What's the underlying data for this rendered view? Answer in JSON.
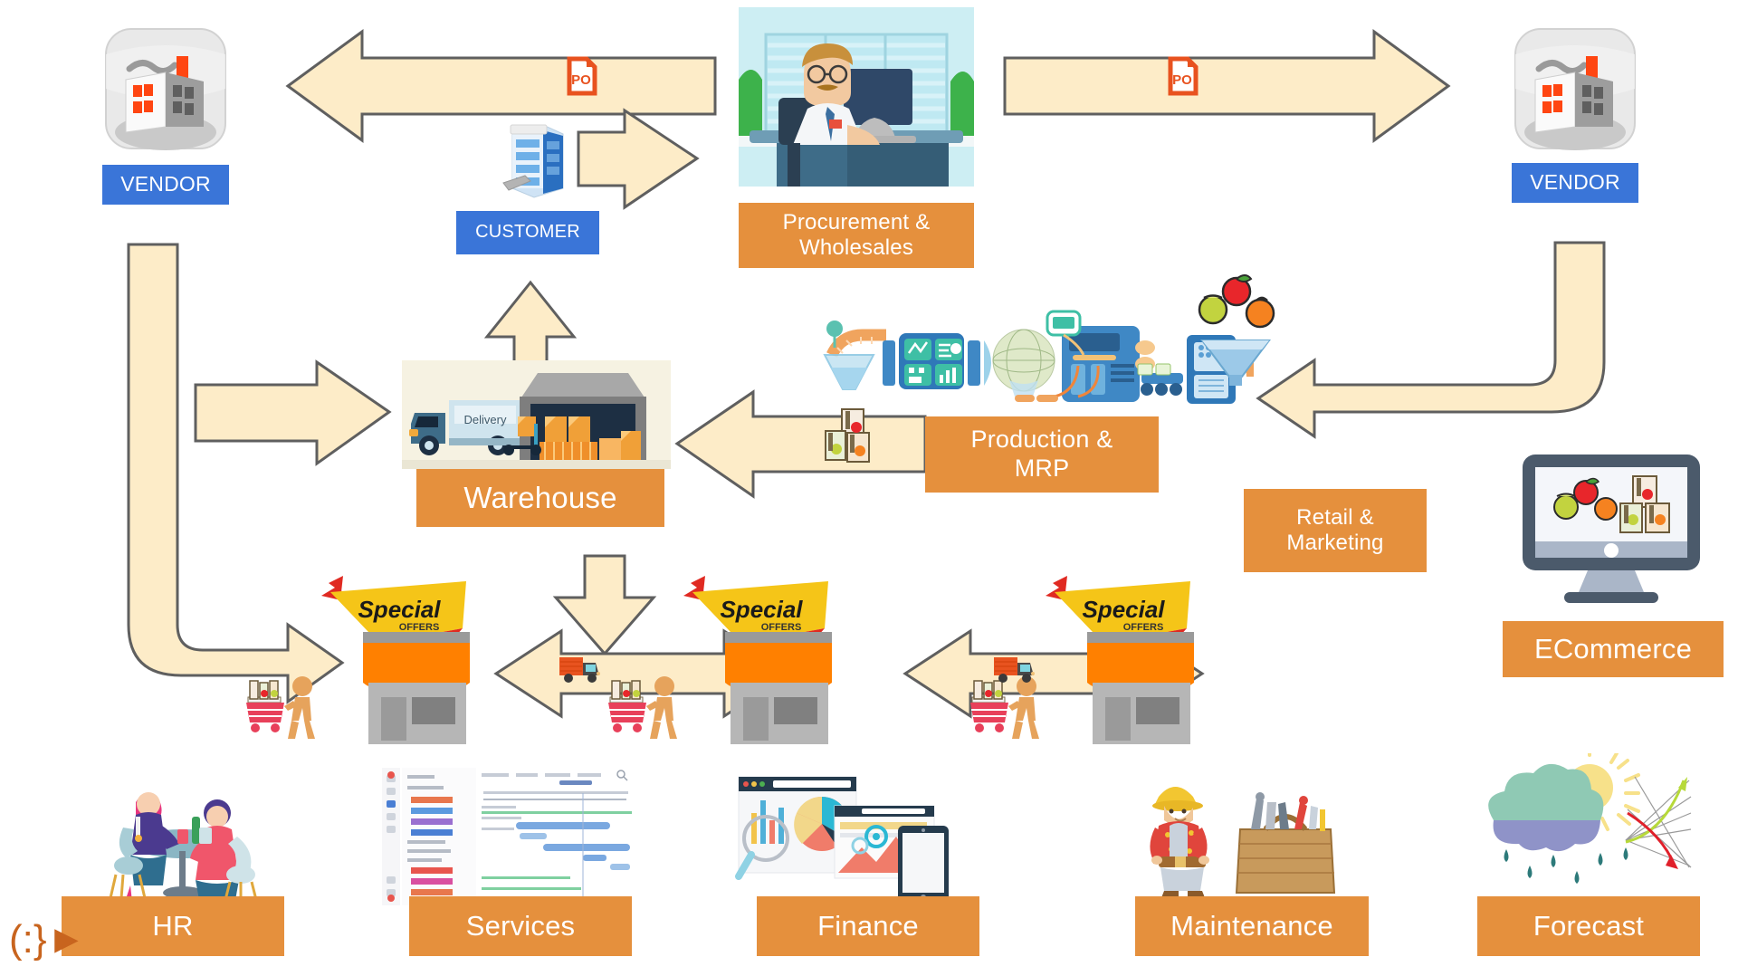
{
  "diagram": {
    "title": "ERP Supply Chain Flow",
    "type": "process-flow",
    "colors": {
      "node_orange": "#e5903d",
      "node_blue": "#3a75d8",
      "arrow_fill": "#fdecc8",
      "arrow_stroke": "#5f5f5f",
      "label_text": "#ffffff",
      "po_icon": "#e8521f"
    }
  },
  "nodes": {
    "vendor_left": {
      "label": "VENDOR",
      "style": "blue",
      "icon": "factory-icon"
    },
    "vendor_right": {
      "label": "VENDOR",
      "style": "blue",
      "icon": "factory-icon"
    },
    "customer": {
      "label": "CUSTOMER",
      "style": "blue",
      "icon": "office-building-icon"
    },
    "procurement": {
      "label": "Procurement &\nWholesales",
      "line1": "Procurement &",
      "line2": "Wholesales",
      "style": "orange",
      "icon": "office-worker-illustration"
    },
    "warehouse": {
      "label": "Warehouse",
      "style": "orange",
      "icon": "delivery-warehouse-illustration"
    },
    "production": {
      "label": "Production &\nMRP",
      "line1": "Production &",
      "line2": "MRP",
      "style": "orange",
      "icon": "production-line-illustration"
    },
    "retail": {
      "label": "Retail &\nMarketing",
      "line1": "Retail &",
      "line2": "Marketing",
      "style": "orange",
      "icon": "none"
    },
    "ecommerce": {
      "label": "ECommerce",
      "style": "orange",
      "icon": "monitor-storefront-illustration"
    }
  },
  "bottom_modules": [
    {
      "label": "HR",
      "icon": "people-meeting-illustration"
    },
    {
      "label": "Services",
      "icon": "gantt-chart-screenshot"
    },
    {
      "label": "Finance",
      "icon": "analytics-dashboard-illustration"
    },
    {
      "label": "Maintenance",
      "icon": "worker-toolbox-illustration"
    },
    {
      "label": "Forecast",
      "icon": "weather-trend-illustration"
    }
  ],
  "shops": [
    {
      "name": "shop-left",
      "banner": "Special",
      "banner_sub": "OFFERS"
    },
    {
      "name": "shop-center",
      "banner": "Special",
      "banner_sub": "OFFERS"
    },
    {
      "name": "shop-right",
      "banner": "Special",
      "banner_sub": "OFFERS"
    }
  ],
  "arrows": [
    {
      "name": "procurement-to-vendor-left",
      "direction": "left",
      "badge": "PO"
    },
    {
      "name": "procurement-to-vendor-right",
      "direction": "right",
      "badge": "PO"
    },
    {
      "name": "customer-to-procurement",
      "direction": "right",
      "badge": ""
    },
    {
      "name": "warehouse-to-customer",
      "direction": "up",
      "badge": ""
    },
    {
      "name": "vendor-left-to-shop",
      "direction": "elbow-down-right",
      "badge": ""
    },
    {
      "name": "vendor-left-to-warehouse",
      "direction": "right",
      "badge": ""
    },
    {
      "name": "production-to-warehouse",
      "direction": "left",
      "badge": ""
    },
    {
      "name": "vendor-right-to-production",
      "direction": "elbow-down-left",
      "badge": ""
    },
    {
      "name": "warehouse-to-shop",
      "direction": "down",
      "badge": ""
    },
    {
      "name": "shop-left-shop-center",
      "direction": "both",
      "badge": "truck"
    },
    {
      "name": "shop-center-shop-right",
      "direction": "both",
      "badge": "truck"
    }
  ],
  "po_badges": [
    {
      "text": "PO",
      "name": "po-document-icon-left"
    },
    {
      "text": "PO",
      "name": "po-document-icon-right"
    }
  ],
  "watermark": {
    "text": "(:}►",
    "color": "#c8641e"
  }
}
